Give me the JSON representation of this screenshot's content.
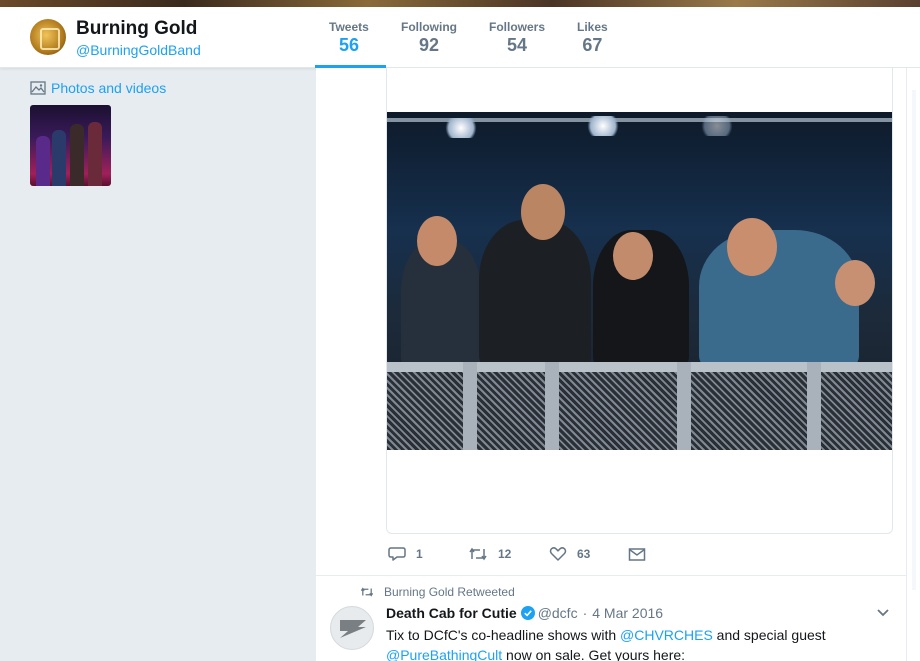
{
  "profile": {
    "name": "Burning Gold",
    "handle": "@BurningGoldBand"
  },
  "stats": [
    {
      "label": "Tweets",
      "value": "56",
      "active": true
    },
    {
      "label": "Following",
      "value": "92",
      "active": false
    },
    {
      "label": "Followers",
      "value": "54",
      "active": false
    },
    {
      "label": "Likes",
      "value": "67",
      "active": false
    }
  ],
  "sidebar": {
    "photos_label": "Photos and videos",
    "photo_icon": "image-icon"
  },
  "tweet_actions": {
    "reply_count": "1",
    "retweet_count": "12",
    "like_count": "63",
    "icons": [
      "reply-icon",
      "retweet-icon",
      "heart-icon",
      "envelope-icon"
    ]
  },
  "retweet": {
    "context": "Burning Gold Retweeted",
    "author": "Death Cab for Cutie",
    "handle": "@dcfc",
    "separator": "·",
    "date": "4 Mar 2016",
    "text_part1": "Tix to DCfC's co-headline shows with ",
    "mention1": "@CHVRCHES",
    "text_part2": " and special guest ",
    "mention2": "@PureBathingCult",
    "text_part3": " now on sale. Get yours here:"
  },
  "colors": {
    "accent": "#1da1f2",
    "muted": "#657786",
    "background": "#e6ecf0"
  }
}
